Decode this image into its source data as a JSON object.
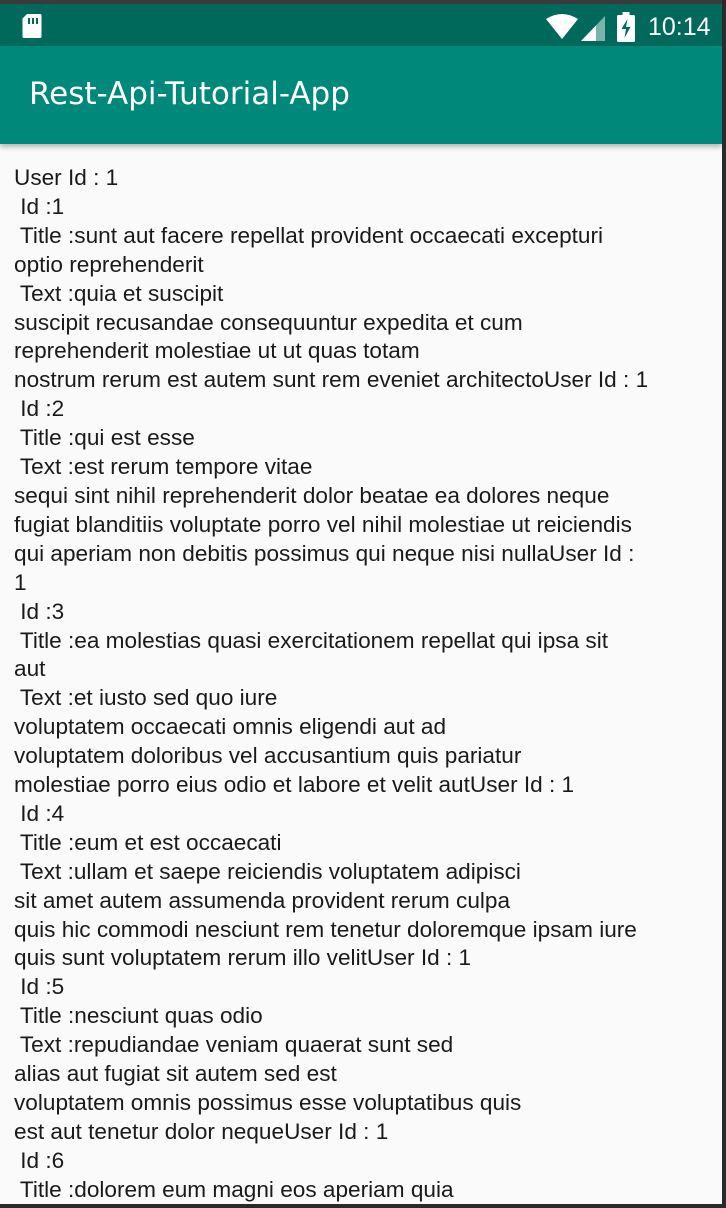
{
  "status_bar": {
    "time": "10:14",
    "icons": [
      "sim-card-icon",
      "wifi-icon",
      "signal-icon",
      "battery-charging-icon"
    ],
    "color": "#00695c"
  },
  "app_bar": {
    "title": "Rest-Api-Tutorial-App",
    "color": "#00897b"
  },
  "content": {
    "background": "#fafafa",
    "text": "User Id : 1\n Id :1\n Title :sunt aut facere repellat provident occaecati excepturi\noptio reprehenderit\n Text :quia et suscipit\nsuscipit recusandae consequuntur expedita et cum\nreprehenderit molestiae ut ut quas totam\nnostrum rerum est autem sunt rem eveniet architectoUser Id : 1\n Id :2\n Title :qui est esse\n Text :est rerum tempore vitae\nsequi sint nihil reprehenderit dolor beatae ea dolores neque\nfugiat blanditiis voluptate porro vel nihil molestiae ut reiciendis\nqui aperiam non debitis possimus qui neque nisi nullaUser Id :\n1\n Id :3\n Title :ea molestias quasi exercitationem repellat qui ipsa sit\naut\n Text :et iusto sed quo iure\nvoluptatem occaecati omnis eligendi aut ad\nvoluptatem doloribus vel accusantium quis pariatur\nmolestiae porro eius odio et labore et velit autUser Id : 1\n Id :4\n Title :eum et est occaecati\n Text :ullam et saepe reiciendis voluptatem adipisci\nsit amet autem assumenda provident rerum culpa\nquis hic commodi nesciunt rem tenetur doloremque ipsam iure\nquis sunt voluptatem rerum illo velitUser Id : 1\n Id :5\n Title :nesciunt quas odio\n Text :repudiandae veniam quaerat sunt sed\nalias aut fugiat sit autem sed est\nvoluptatem omnis possimus esse voluptatibus quis\nest aut tenetur dolor nequeUser Id : 1\n Id :6\n Title :dolorem eum magni eos aperiam quia"
  }
}
